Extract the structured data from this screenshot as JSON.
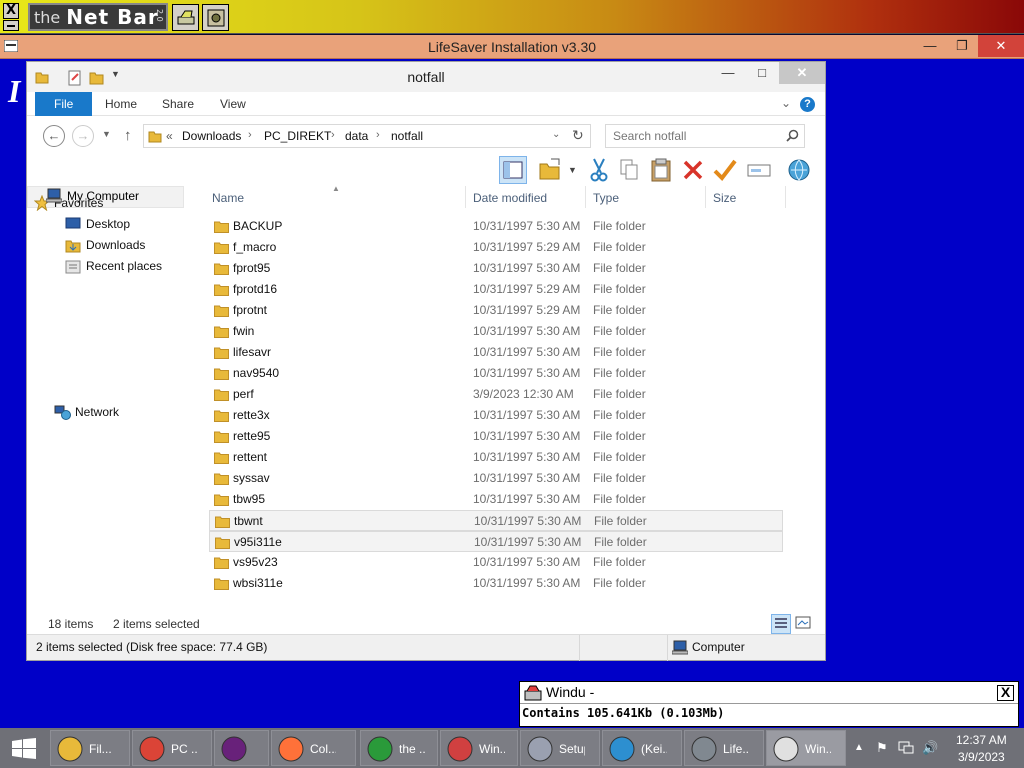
{
  "netbar": {
    "logo_the": "the",
    "logo_main": "Net Bar",
    "logo_version": "2.0",
    "close_label": "X"
  },
  "lifesaver": {
    "title": "LifeSaver Installation v3.30",
    "bg_text": "I"
  },
  "explorer": {
    "title": "notfall",
    "ribbon_tabs": [
      "File",
      "Home",
      "Share",
      "View"
    ],
    "address": {
      "overflow": "«",
      "crumbs": [
        "Downloads",
        "PC_DIREKT",
        "data",
        "notfall"
      ]
    },
    "search_placeholder": "Search notfall",
    "nav_pane": {
      "favorites": "Favorites",
      "desktop": "Desktop",
      "downloads": "Downloads",
      "recent": "Recent places",
      "my_computer": "My Computer",
      "network": "Network"
    },
    "columns": [
      "Name",
      "Date modified",
      "Type",
      "Size"
    ],
    "files": [
      {
        "name": "BACKUP",
        "date": "10/31/1997 5:30 AM",
        "type": "File folder"
      },
      {
        "name": "f_macro",
        "date": "10/31/1997 5:29 AM",
        "type": "File folder"
      },
      {
        "name": "fprot95",
        "date": "10/31/1997 5:30 AM",
        "type": "File folder"
      },
      {
        "name": "fprotd16",
        "date": "10/31/1997 5:29 AM",
        "type": "File folder"
      },
      {
        "name": "fprotnt",
        "date": "10/31/1997 5:29 AM",
        "type": "File folder"
      },
      {
        "name": "fwin",
        "date": "10/31/1997 5:30 AM",
        "type": "File folder"
      },
      {
        "name": "lifesavr",
        "date": "10/31/1997 5:30 AM",
        "type": "File folder"
      },
      {
        "name": "nav9540",
        "date": "10/31/1997 5:30 AM",
        "type": "File folder"
      },
      {
        "name": "perf",
        "date": "3/9/2023 12:30 AM",
        "type": "File folder"
      },
      {
        "name": "rette3x",
        "date": "10/31/1997 5:30 AM",
        "type": "File folder"
      },
      {
        "name": "rette95",
        "date": "10/31/1997 5:30 AM",
        "type": "File folder"
      },
      {
        "name": "rettent",
        "date": "10/31/1997 5:30 AM",
        "type": "File folder"
      },
      {
        "name": "syssav",
        "date": "10/31/1997 5:30 AM",
        "type": "File folder"
      },
      {
        "name": "tbw95",
        "date": "10/31/1997 5:30 AM",
        "type": "File folder"
      },
      {
        "name": "tbwnt",
        "date": "10/31/1997 5:30 AM",
        "type": "File folder",
        "selected": true
      },
      {
        "name": "v95i311e",
        "date": "10/31/1997 5:30 AM",
        "type": "File folder",
        "selected": true
      },
      {
        "name": "vs95v23",
        "date": "10/31/1997 5:30 AM",
        "type": "File folder"
      },
      {
        "name": "wbsi311e",
        "date": "10/31/1997 5:30 AM",
        "type": "File folder"
      }
    ],
    "item_count": "18 items",
    "selected_count": "2 items selected",
    "status_text": "2 items selected (Disk free space: 77.4 GB)",
    "status_location": "Computer"
  },
  "windu": {
    "title": "Windu -",
    "close_label": "X",
    "message": "Contains 105.641Kb (0.103Mb)"
  },
  "taskbar": {
    "items": [
      {
        "label": "Fil...",
        "icon": "file-explorer-icon"
      },
      {
        "label": "PC ...",
        "icon": "chrome-icon"
      },
      {
        "label": "",
        "icon": "visual-studio-icon"
      },
      {
        "label": "Col...",
        "icon": "firefox-icon"
      },
      {
        "label": "the ...",
        "icon": "netbar-globe-icon"
      },
      {
        "label": "Win...",
        "icon": "windu-icon"
      },
      {
        "label": "Setup",
        "icon": "setup-icon"
      },
      {
        "label": "(Kei...",
        "icon": "magnifier-globe-icon"
      },
      {
        "label": "Life...",
        "icon": "lifesaver-icon"
      },
      {
        "label": "Win...",
        "icon": "window-app-icon"
      }
    ],
    "clock_time": "12:37 AM",
    "clock_date": "3/9/2023"
  },
  "colors": {
    "accent": "#1979ca",
    "lifesaver_bg": "#0000c8",
    "lifesaver_title": "#e9a27a",
    "taskbar": "#6f7077"
  }
}
